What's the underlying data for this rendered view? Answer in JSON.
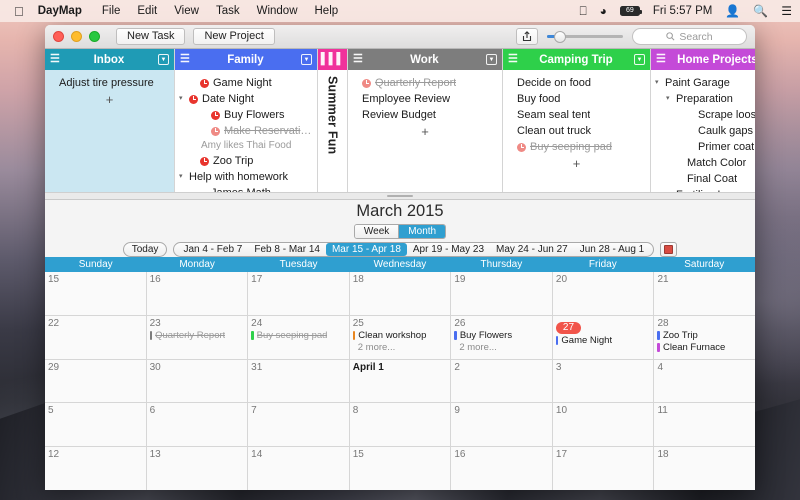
{
  "menubar": {
    "apple_icon": "apple-icon",
    "app_name": "DayMap",
    "items": [
      "File",
      "Edit",
      "View",
      "Task",
      "Window",
      "Help"
    ],
    "status_icons": [
      "airplay-icon",
      "wifi-icon",
      "battery-icon"
    ],
    "battery_level": "69",
    "clock": "Fri 5:57 PM",
    "user_icon": "user-icon",
    "search_icon": "spotlight-search-icon",
    "notification_icon": "notification-center-icon"
  },
  "toolbar": {
    "new_task_label": "New Task",
    "new_project_label": "New Project",
    "share_icon": "share-icon",
    "zoom_slider_icon": "zoom-slider",
    "search_placeholder": "Search",
    "search_icon": "search-icon"
  },
  "columns": [
    {
      "title": "Inbox",
      "color": "#1f9bb5",
      "body_bg": "#cbe7f2",
      "menu_icon": "hamburger-icon",
      "options_icon": "chevron-down-box-icon",
      "collapsed": false,
      "tasks": [
        {
          "label": "Adjust tire pressure",
          "indent": 0,
          "clock": false,
          "done": false,
          "disclosure": ""
        }
      ],
      "add_label": "+"
    },
    {
      "title": "Family",
      "color": "#4a6ef0",
      "body_bg": "#ffffff",
      "menu_icon": "hamburger-icon",
      "options_icon": "chevron-down-box-icon",
      "collapsed": false,
      "tasks": [
        {
          "label": "Game Night",
          "indent": 1,
          "clock": true,
          "done": false,
          "disclosure": ""
        },
        {
          "label": "Date Night",
          "indent": 0,
          "clock": true,
          "done": false,
          "disclosure": "▾"
        },
        {
          "label": "Buy Flowers",
          "indent": 2,
          "clock": true,
          "done": false,
          "disclosure": ""
        },
        {
          "label": "Make Reservations",
          "indent": 2,
          "clock": true,
          "done": true,
          "disclosure": ""
        },
        {
          "label": "Amy likes Thai Food",
          "indent": 2,
          "clock": false,
          "done": false,
          "note": true,
          "disclosure": ""
        },
        {
          "label": "Zoo Trip",
          "indent": 1,
          "clock": true,
          "done": false,
          "disclosure": ""
        },
        {
          "label": "Help with homework",
          "indent": 0,
          "clock": false,
          "done": false,
          "disclosure": "▾"
        },
        {
          "label": "James Math",
          "indent": 2,
          "clock": false,
          "done": false,
          "disclosure": ""
        }
      ],
      "add_label": ""
    },
    {
      "title": "Summer Fun",
      "color": "#f0329b",
      "body_bg": "#ffffff",
      "menu_icon": "columns-icon",
      "options_icon": "",
      "collapsed": true,
      "tasks": [],
      "add_label": ""
    },
    {
      "title": "Work",
      "color": "#7d7d7d",
      "body_bg": "#ffffff",
      "menu_icon": "hamburger-icon",
      "options_icon": "chevron-down-box-icon",
      "collapsed": false,
      "tasks": [
        {
          "label": "Quarterly Report",
          "indent": 0,
          "clock": true,
          "done": true,
          "disclosure": ""
        },
        {
          "label": "Employee Review",
          "indent": 0,
          "clock": false,
          "done": false,
          "disclosure": ""
        },
        {
          "label": "Review Budget",
          "indent": 0,
          "clock": false,
          "done": false,
          "disclosure": ""
        }
      ],
      "add_label": "+"
    },
    {
      "title": "Camping Trip",
      "color": "#2ed04a",
      "body_bg": "#ffffff",
      "menu_icon": "hamburger-icon",
      "options_icon": "chevron-down-box-icon",
      "collapsed": false,
      "tasks": [
        {
          "label": "Decide on food",
          "indent": 0,
          "clock": false,
          "done": false,
          "disclosure": ""
        },
        {
          "label": "Buy food",
          "indent": 0,
          "clock": false,
          "done": false,
          "disclosure": ""
        },
        {
          "label": "Seam seal tent",
          "indent": 0,
          "clock": false,
          "done": false,
          "disclosure": ""
        },
        {
          "label": "Clean out truck",
          "indent": 0,
          "clock": false,
          "done": false,
          "disclosure": ""
        },
        {
          "label": "Buy seeping pad",
          "indent": 0,
          "clock": true,
          "done": true,
          "disclosure": ""
        }
      ],
      "add_label": "+"
    },
    {
      "title": "Home Projects",
      "color": "#c44ad8",
      "body_bg": "#ffffff",
      "menu_icon": "hamburger-icon",
      "options_icon": "chevron-down-box-icon",
      "collapsed": false,
      "tasks": [
        {
          "label": "Paint Garage",
          "indent": 0,
          "clock": false,
          "done": false,
          "disclosure": "▾"
        },
        {
          "label": "Preparation",
          "indent": 1,
          "clock": false,
          "done": false,
          "disclosure": "▾"
        },
        {
          "label": "Scrape loose paint",
          "indent": 3,
          "clock": false,
          "done": false,
          "disclosure": ""
        },
        {
          "label": "Caulk gaps",
          "indent": 3,
          "clock": false,
          "done": false,
          "disclosure": ""
        },
        {
          "label": "Primer coat",
          "indent": 3,
          "clock": false,
          "done": false,
          "disclosure": ""
        },
        {
          "label": "Match Color",
          "indent": 2,
          "clock": false,
          "done": false,
          "disclosure": ""
        },
        {
          "label": "Final Coat",
          "indent": 2,
          "clock": false,
          "done": false,
          "disclosure": ""
        },
        {
          "label": "Fertilize Lawn",
          "indent": 1,
          "clock": false,
          "done": false,
          "disclosure": ""
        }
      ],
      "add_label": ""
    }
  ],
  "calendar": {
    "title": "March 2015",
    "view_modes": [
      "Week",
      "Month"
    ],
    "active_view": "Month",
    "today_label": "Today",
    "ranges": [
      "Jan 4 - Feb 7",
      "Feb 8 - Mar 14",
      "Mar 15 - Apr 18",
      "Apr 19 - May 23",
      "May 24 - Jun 27",
      "Jun 28 - Aug 1"
    ],
    "active_range": "Mar 15 - Apr 18",
    "calendar_picker_icon": "calendar-icon",
    "day_names": [
      "Sunday",
      "Monday",
      "Tuesday",
      "Wednesday",
      "Thursday",
      "Friday",
      "Saturday"
    ],
    "weeks": [
      [
        {
          "num": "15",
          "events": []
        },
        {
          "num": "16",
          "events": []
        },
        {
          "num": "17",
          "events": []
        },
        {
          "num": "18",
          "events": []
        },
        {
          "num": "19",
          "events": []
        },
        {
          "num": "20",
          "events": []
        },
        {
          "num": "21",
          "events": []
        }
      ],
      [
        {
          "num": "22",
          "events": []
        },
        {
          "num": "23",
          "events": [
            {
              "label": "Quarterly Report",
              "color": "#7d7d7d",
              "done": true
            }
          ]
        },
        {
          "num": "24",
          "events": [
            {
              "label": "Buy seeping pad",
              "color": "#2ed04a",
              "done": true
            }
          ]
        },
        {
          "num": "25",
          "events": [
            {
              "label": "Clean workshop",
              "color": "#e8851f",
              "done": false
            }
          ],
          "more": "2 more..."
        },
        {
          "num": "26",
          "events": [
            {
              "label": "Buy Flowers",
              "color": "#4a6ef0",
              "done": false
            }
          ],
          "more": "2 more..."
        },
        {
          "num": "27",
          "today": true,
          "events": [
            {
              "label": "Game Night",
              "color": "#4a6ef0",
              "done": false
            }
          ]
        },
        {
          "num": "28",
          "events": [
            {
              "label": "Zoo Trip",
              "color": "#4a6ef0",
              "done": false
            },
            {
              "label": "Clean Furnace",
              "color": "#c44ad8",
              "done": false
            }
          ]
        }
      ],
      [
        {
          "num": "29",
          "events": []
        },
        {
          "num": "30",
          "events": []
        },
        {
          "num": "31",
          "events": []
        },
        {
          "num": "April 1",
          "strong": true,
          "events": []
        },
        {
          "num": "2",
          "events": []
        },
        {
          "num": "3",
          "events": []
        },
        {
          "num": "4",
          "events": []
        }
      ],
      [
        {
          "num": "5",
          "events": []
        },
        {
          "num": "6",
          "events": []
        },
        {
          "num": "7",
          "events": []
        },
        {
          "num": "8",
          "events": []
        },
        {
          "num": "9",
          "events": []
        },
        {
          "num": "10",
          "events": []
        },
        {
          "num": "11",
          "events": []
        }
      ],
      [
        {
          "num": "12",
          "events": []
        },
        {
          "num": "13",
          "events": []
        },
        {
          "num": "14",
          "events": []
        },
        {
          "num": "15",
          "events": []
        },
        {
          "num": "16",
          "events": []
        },
        {
          "num": "17",
          "events": []
        },
        {
          "num": "18",
          "events": []
        }
      ]
    ]
  }
}
